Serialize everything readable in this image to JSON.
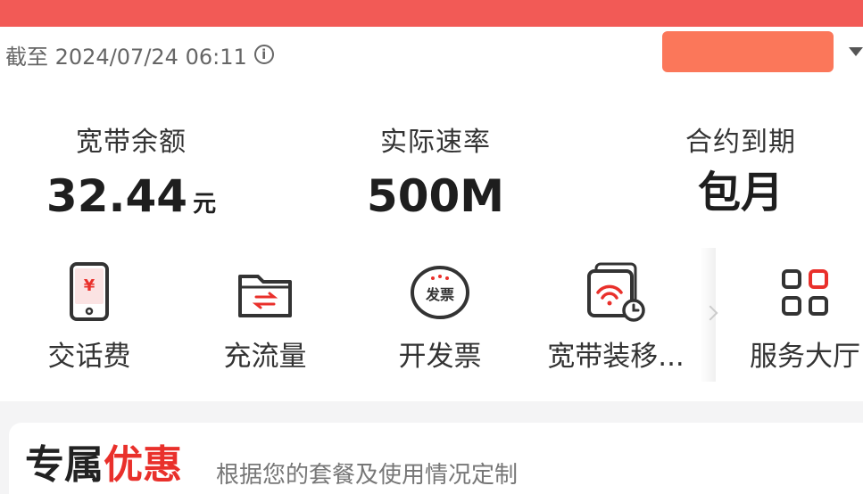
{
  "header": {
    "timestamp": "截至 2024/07/24 06:11",
    "info_icon": "info-circle-icon"
  },
  "stats": [
    {
      "label": "宽带余额",
      "value": "32.44",
      "unit": "元"
    },
    {
      "label": "实际速率",
      "value": "500M"
    },
    {
      "label": "合约到期",
      "value": "包月"
    }
  ],
  "shortcuts": [
    {
      "label": "交话费",
      "icon": "phone-yuan-icon"
    },
    {
      "label": "充流量",
      "icon": "folder-transfer-icon"
    },
    {
      "label": "开发票",
      "icon": "invoice-icon",
      "badge": "发票"
    },
    {
      "label": "宽带装移...",
      "icon": "wifi-router-clock-icon"
    },
    {
      "label": "服务大厅",
      "icon": "grid-apps-icon"
    }
  ],
  "promo": {
    "title_prefix": "专属",
    "title_accent": "优惠",
    "subtitle": "根据您的套餐及使用情况定制"
  },
  "colors": {
    "brand": "#f25a56",
    "accent": "#e9302b",
    "selector": "#fb775a"
  }
}
